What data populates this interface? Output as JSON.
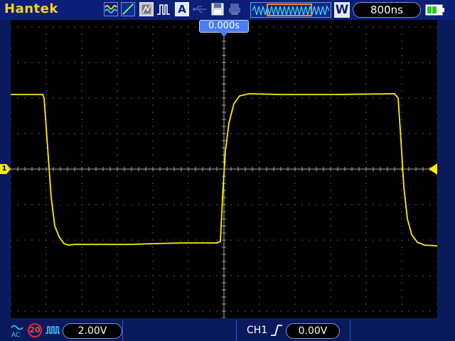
{
  "header": {
    "brand": "Hantek",
    "icons": [
      "waveform-icon",
      "ramp-icon",
      "persistence-icon",
      "pulse-icon",
      "auto-icon",
      "usb-icon",
      "save-disk-icon",
      "print-icon"
    ],
    "auto_label": "A",
    "zoom_label": "W",
    "timebase": "800ns"
  },
  "screen": {
    "trigger_position": "0.000s",
    "channel_marker": "1",
    "trace_color": "#ffee00",
    "grid_color": "#7a7a7a"
  },
  "footer": {
    "bandwidth_limit": "20",
    "volts_per_div": "2.00V",
    "trigger_source": "CH1",
    "trigger_level": "0.00V"
  },
  "colors": {
    "accent": "#4a7ef2",
    "brand": "#ffd21a",
    "background": "#0a1a5c"
  }
}
